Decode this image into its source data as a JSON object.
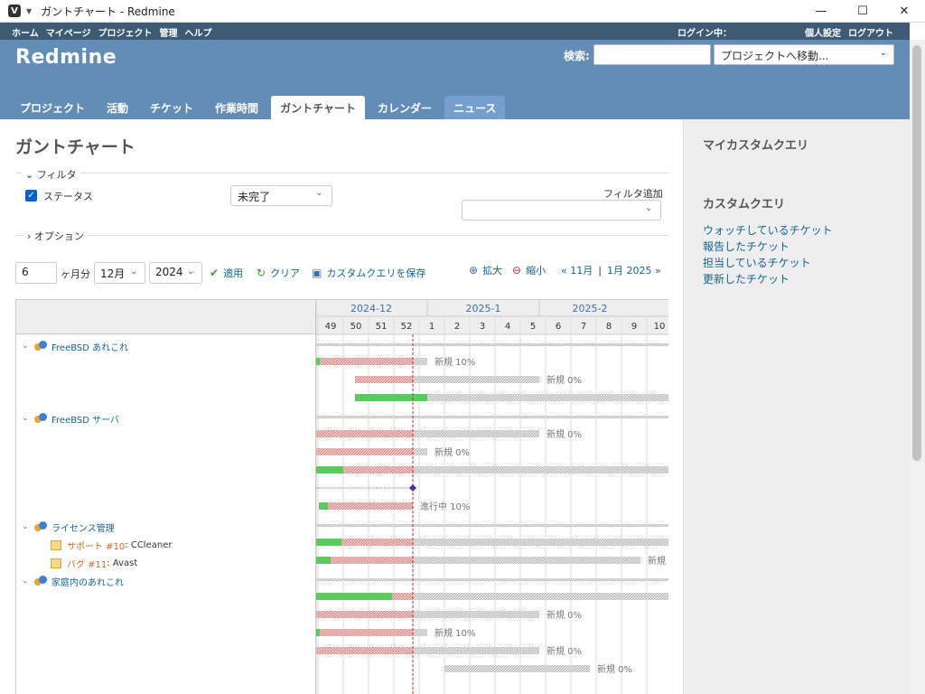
{
  "window": {
    "title": "ガントチャート - Redmine",
    "minimize_glyph": "—",
    "maximize_glyph": "☐",
    "close_glyph": "✕"
  },
  "top_menu": {
    "items": [
      "ホーム",
      "マイページ",
      "プロジェクト",
      "管理",
      "ヘルプ"
    ],
    "login_status": "ログイン中：",
    "account_items": [
      "個人設定",
      "ログアウト"
    ]
  },
  "header": {
    "site_title": "Redmine",
    "search_label": "検索:",
    "search_value": "",
    "project_jump": "プロジェクトへ移動..."
  },
  "main_menu": {
    "tabs": [
      "プロジェクト",
      "活動",
      "チケット",
      "作業時間",
      "ガントチャート",
      "カレンダー",
      "ニュース"
    ],
    "selected": "ガントチャート"
  },
  "page": {
    "title": "ガントチャート",
    "filter_legend": "フィルタ",
    "status_label": "ステータス",
    "status_value": "未完了",
    "add_filter_label": "フィルタ追加",
    "options_legend": "オプション",
    "months_value": "6",
    "months_label": "ヶ月分",
    "month_select": "12月",
    "year_select": "2024",
    "apply": "適用",
    "clear": "クリア",
    "save_query": "カスタムクエリを保存",
    "zoom_in": "拡大",
    "zoom_out": "縮小",
    "prev_link": "« 11月",
    "separator": "|",
    "next_link": "1月 2025 »"
  },
  "sidebar": {
    "my_queries_heading": "マイカスタムクエリ",
    "queries_heading": "カスタムクエリ",
    "queries": [
      "ウォッチしているチケット",
      "報告したチケット",
      "担当しているチケット",
      "更新したチケット"
    ]
  },
  "gantt": {
    "months": [
      "2024-12",
      "2025-1",
      "2025-2"
    ],
    "weeks": [
      "49",
      "50",
      "51",
      "52",
      "1",
      "2",
      "3",
      "4",
      "5",
      "6",
      "7",
      "8",
      "9",
      "10"
    ],
    "subjects": [
      {
        "kind": "project",
        "label": "FreeBSD あれこれ"
      },
      {
        "kind": "project",
        "label": "FreeBSD サーバ"
      },
      {
        "kind": "project",
        "label": "ライセンス管理"
      },
      {
        "kind": "issue",
        "tracker": "サポート #10",
        "subject": ": CCleaner"
      },
      {
        "kind": "issue",
        "tracker": "バグ #11",
        "subject": ": Avast"
      },
      {
        "kind": "project",
        "label": "家庭内のあれこれ"
      }
    ],
    "bar_labels": [
      "新規 10%",
      "新規 0%",
      "新規 0%",
      "新規 0%",
      "進行中 10%",
      "新規",
      "新規 0%",
      "新規 10%",
      "新規 0%",
      "新規 0%"
    ]
  }
}
